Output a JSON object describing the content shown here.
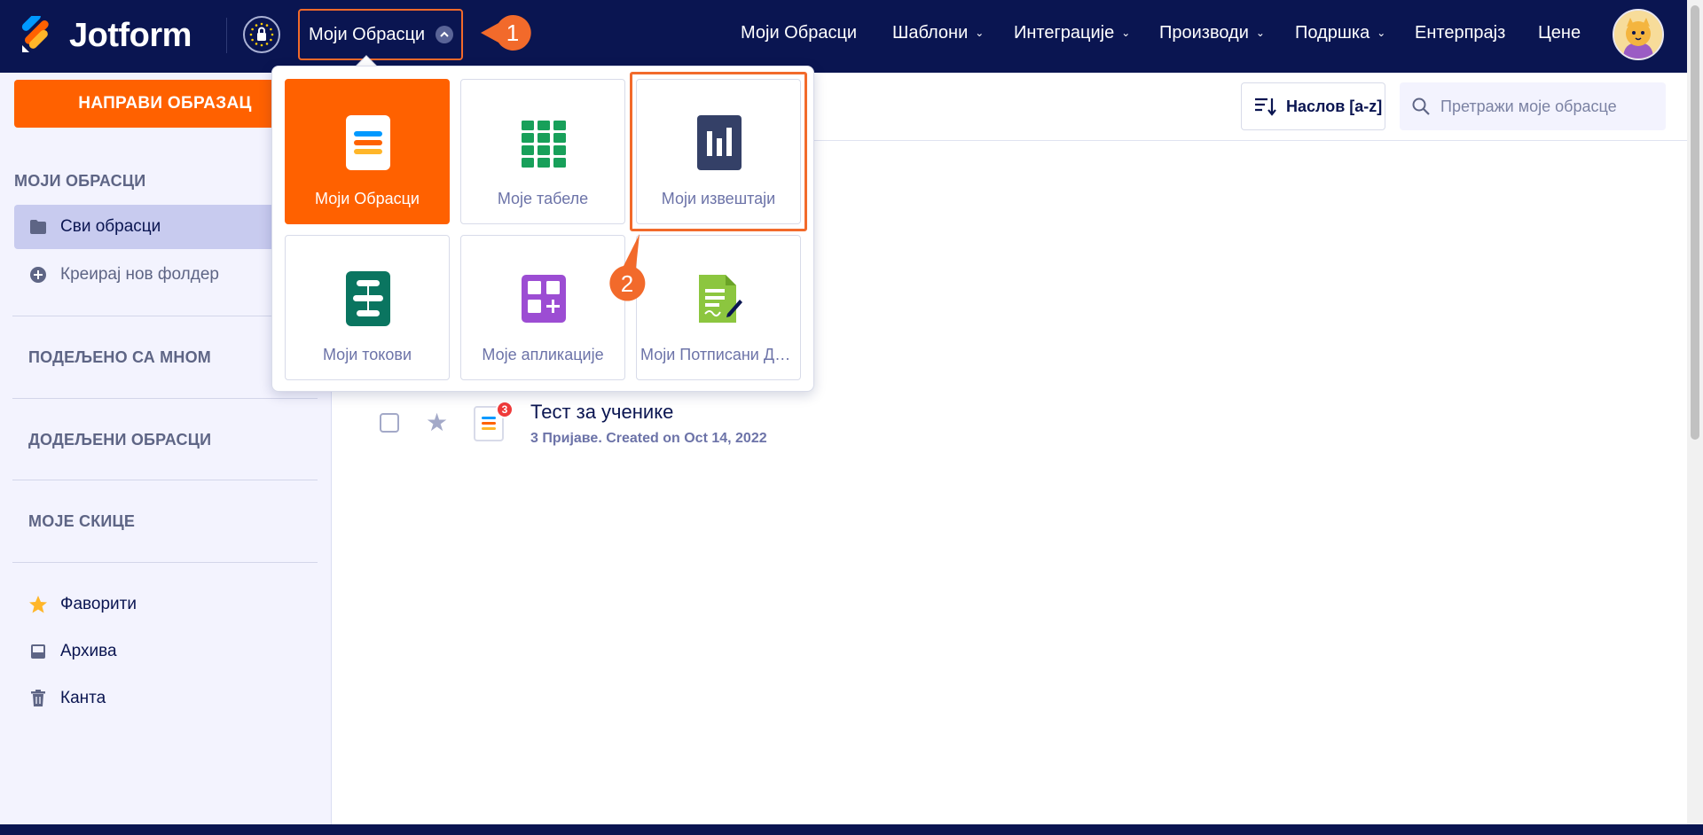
{
  "header": {
    "logo_text": "Jotform",
    "my_forms_button": "Моји Обрасци",
    "callout_1": "1",
    "nav": [
      {
        "label": "Моји Обрасци",
        "has_caret": false
      },
      {
        "label": "Шаблони",
        "has_caret": true
      },
      {
        "label": "Интеграције",
        "has_caret": true
      },
      {
        "label": "Производи",
        "has_caret": true
      },
      {
        "label": "Подршка",
        "has_caret": true
      },
      {
        "label": "Ентерпрајз",
        "has_caret": false
      },
      {
        "label": "Цене",
        "has_caret": false
      }
    ],
    "caret": "⌄"
  },
  "sidebar": {
    "create_button": "НАПРАВИ ОБРАЗАЦ",
    "section_title": "МОЈИ ОБРАСЦИ",
    "all_forms": "Сви обрасци",
    "create_folder": "Креирај нов фолдер",
    "shared_with_me": "ПОДЕЉЕНО СА МНОМ",
    "assigned_forms": "ДОДЕЉЕНИ ОБРАСЦИ",
    "my_drafts": "МОЈЕ СКИЦЕ",
    "favorites": "Фаворити",
    "archive": "Архива",
    "trash": "Канта"
  },
  "toolbar": {
    "sort_label": "Наслов [a-z]",
    "search_placeholder": "Претражи моје обрасце"
  },
  "form_list": [
    {
      "title": "Тест за ученике",
      "meta": "3 Пријаве. Created on Oct 14, 2022",
      "badge": "3"
    }
  ],
  "dropdown": {
    "tiles": [
      {
        "label": "Моји Обрасци",
        "icon": "forms-icon",
        "active": true
      },
      {
        "label": "Моје табеле",
        "icon": "tables-icon",
        "active": false
      },
      {
        "label": "Моји извештаји",
        "icon": "reports-icon",
        "active": false
      },
      {
        "label": "Моји токови",
        "icon": "workflows-icon",
        "active": false
      },
      {
        "label": "Моје апликације",
        "icon": "apps-icon",
        "active": false
      },
      {
        "label": "Моји Потписани Документи",
        "icon": "sign-icon",
        "active": false
      }
    ],
    "callout_2": "2"
  },
  "colors": {
    "navy": "#0a1551",
    "orange": "#ff6100",
    "callout": "#f26a2b",
    "sidebar_bg": "#f3f3fe",
    "green": "#18a05a",
    "report_navy": "#344067",
    "flow_teal": "#0a7560",
    "apps_purple": "#9c4dd3",
    "sign_lime": "#8cc63f"
  }
}
